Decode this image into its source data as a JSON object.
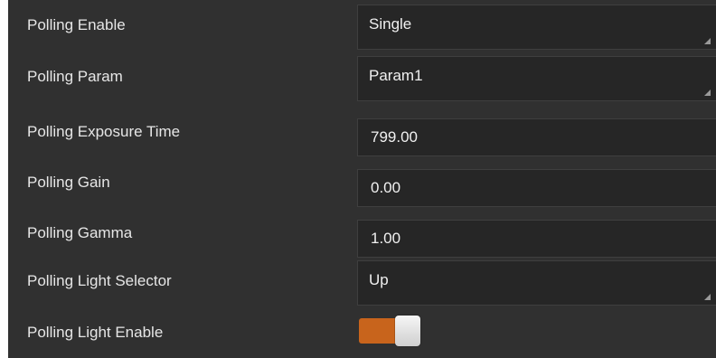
{
  "rows": [
    {
      "label": "Polling Enable",
      "value": "Single",
      "kind": "select"
    },
    {
      "label": "Polling Param",
      "value": "Param1",
      "kind": "select"
    },
    {
      "label": "Polling Exposure Time",
      "value": "799.00",
      "kind": "input"
    },
    {
      "label": "Polling Gain",
      "value": "0.00",
      "kind": "input"
    },
    {
      "label": "Polling Gamma",
      "value": "1.00",
      "kind": "input"
    },
    {
      "label": "Polling Light Selector",
      "value": "Up",
      "kind": "select"
    },
    {
      "label": "Polling Light Enable",
      "on": true,
      "kind": "toggle"
    }
  ],
  "colors": {
    "panel_bg": "#303030",
    "field_bg": "#262626",
    "label_text": "#e6e6e6",
    "toggle_on": "#c8641c"
  }
}
